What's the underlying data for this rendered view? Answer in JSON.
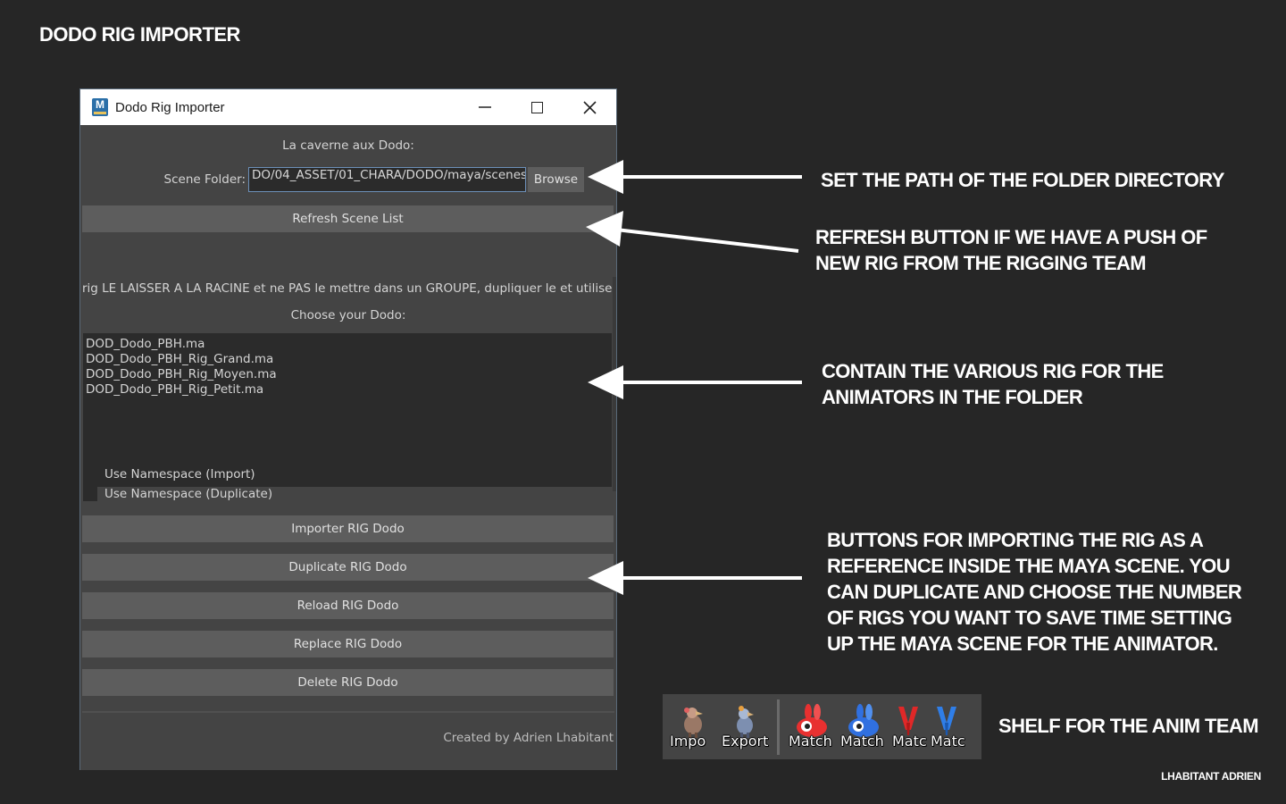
{
  "page": {
    "title": "DODO RIG IMPORTER",
    "signature": "LHABITANT ADRIEN"
  },
  "window": {
    "icon_letter": "M",
    "title": "Dodo Rig Importer",
    "controls": [
      "minimize",
      "maximize",
      "close"
    ],
    "cave_label": "La caverne aux Dodo:",
    "scene_folder_label": "Scene Folder:",
    "scene_folder_value": "DO/04_ASSET/01_CHARA/DODO/maya/scenes",
    "browse_label": "Browse",
    "refresh_label": "Refresh Scene List",
    "note": "rig LE LAISSER A LA RACINE et ne PAS le mettre dans un GROUPE, dupliquer le et utiliser le",
    "choose_label": "Choose your Dodo:",
    "scenes": [
      "DOD_Dodo_PBH.ma",
      "DOD_Dodo_PBH_Rig_Grand.ma",
      "DOD_Dodo_PBH_Rig_Moyen.ma",
      "DOD_Dodo_PBH_Rig_Petit.ma"
    ],
    "checkboxes": [
      {
        "label": "Use Namespace (Import)",
        "checked": false
      },
      {
        "label": "Use Namespace (Duplicate)",
        "checked": false
      }
    ],
    "buttons": {
      "import": "Importer RIG Dodo",
      "duplicate": "Duplicate RIG Dodo",
      "reload": "Reload RIG Dodo",
      "replace": "Replace RIG Dodo",
      "delete": "Delete RIG Dodo"
    },
    "credit": "Created by Adrien Lhabitant"
  },
  "annotations": {
    "path": [
      "SET THE PATH OF THE FOLDER DIRECTORY"
    ],
    "refresh": [
      "REFRESH BUTTON IF WE HAVE A PUSH OF",
      "NEW RIG FROM THE RIGGING TEAM"
    ],
    "list": [
      "CONTAIN THE VARIOUS RIG FOR THE",
      "ANIMATORS IN THE FOLDER"
    ],
    "buttons": [
      "BUTTONS FOR IMPORTING THE RIG AS A",
      "REFERENCE INSIDE THE MAYA SCENE. YOU",
      "CAN DUPLICATE AND CHOOSE THE NUMBER",
      "OF RIGS YOU WANT TO SAVE TIME SETTING",
      "UP THE MAYA SCENE FOR THE ANIMATOR."
    ],
    "shelf": [
      "SHELF FOR THE ANIM TEAM"
    ]
  },
  "shelf": {
    "items": [
      {
        "label": "Impo",
        "icon": "dodo-import-icon"
      },
      {
        "label": "Export",
        "icon": "dodo-export-icon"
      },
      {
        "label": "Match",
        "icon": "rabbit-red-icon"
      },
      {
        "label": "Match",
        "icon": "rabbit-blue-icon"
      },
      {
        "label": "Matc",
        "icon": "tripod-red-icon"
      },
      {
        "label": "Matc",
        "icon": "tripod-blue-icon"
      }
    ]
  },
  "colors": {
    "background": "#262626",
    "maya_panel": "#444444",
    "maya_button": "#5d5d5d",
    "maya_field": "#2b2b2b",
    "annotation_text": "#ffffff"
  }
}
